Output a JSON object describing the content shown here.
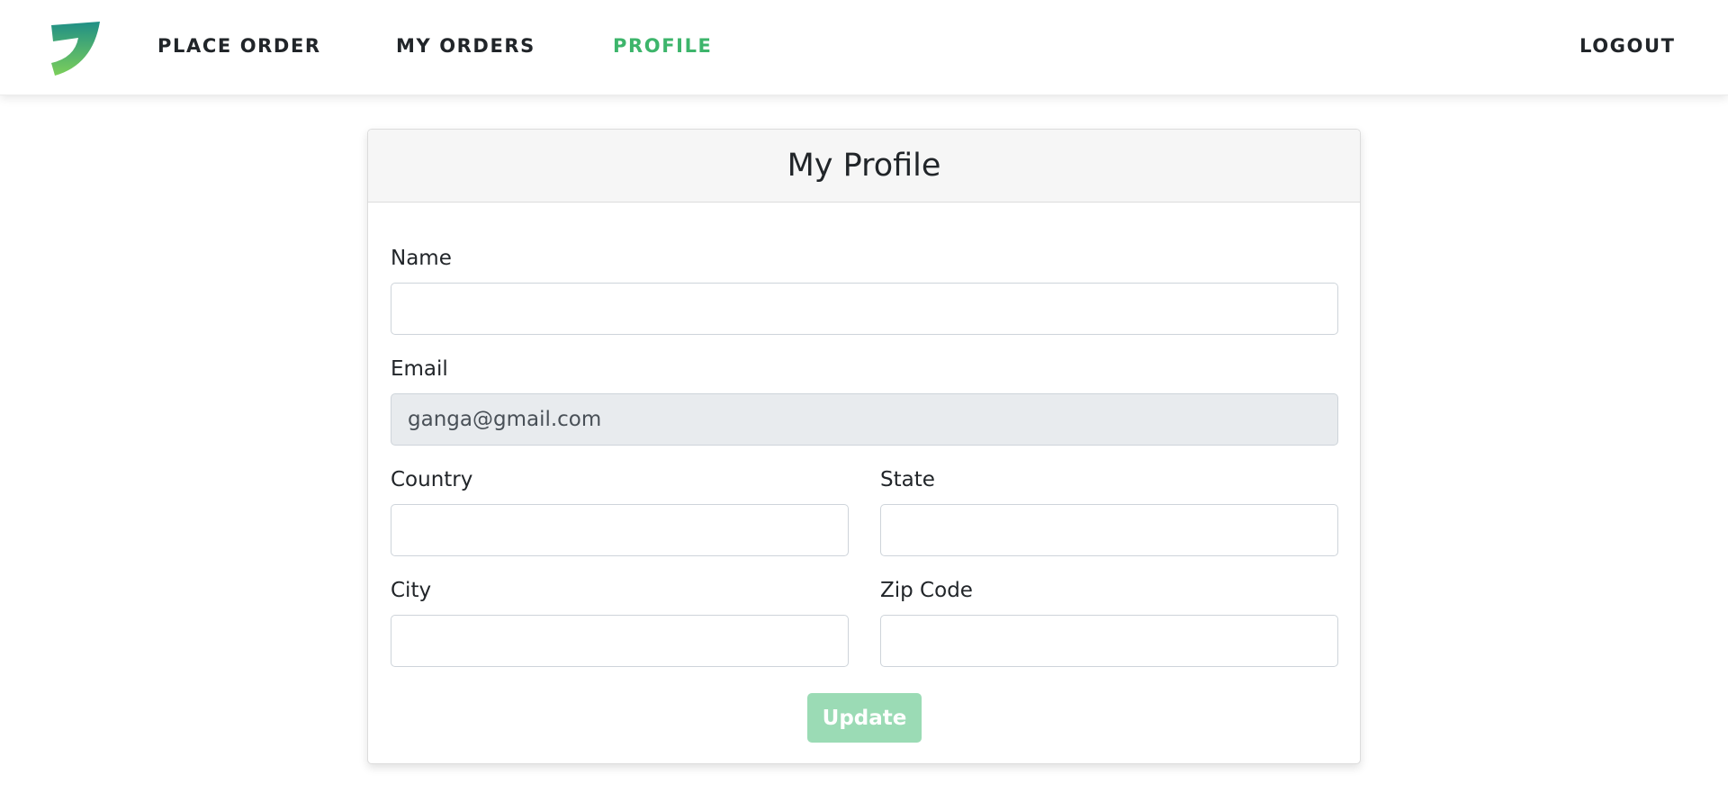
{
  "nav": {
    "items": [
      {
        "label": "PLACE ORDER",
        "active": false
      },
      {
        "label": "MY ORDERS",
        "active": false
      },
      {
        "label": "PROFILE",
        "active": true
      }
    ],
    "logout_label": "LOGOUT",
    "logo_icon": "leaf-logo-icon",
    "active_color": "#3db56b"
  },
  "profile": {
    "title": "My Profile",
    "fields": {
      "name": {
        "label": "Name",
        "value": ""
      },
      "email": {
        "label": "Email",
        "value": "ganga@gmail.com",
        "disabled": true
      },
      "country": {
        "label": "Country",
        "value": ""
      },
      "state": {
        "label": "State",
        "value": ""
      },
      "city": {
        "label": "City",
        "value": ""
      },
      "zip": {
        "label": "Zip Code",
        "value": ""
      }
    },
    "update_label": "Update",
    "update_color": "#9bdbb5"
  }
}
